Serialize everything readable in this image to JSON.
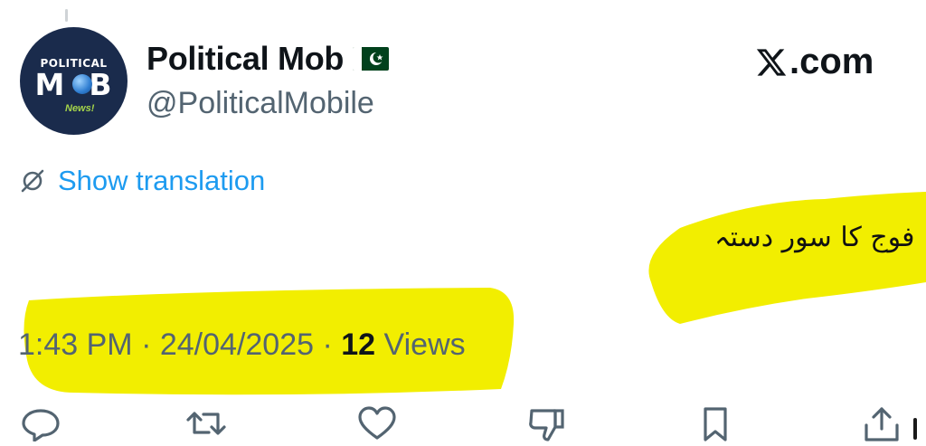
{
  "author": {
    "name": "Political Mob",
    "handle": "@PoliticalMobile",
    "flag_icon": "pakistan-flag-icon",
    "avatar": {
      "line1": "POLITICAL",
      "line2_left": "M",
      "line2_right": "B",
      "line3": "News!"
    }
  },
  "site_label": ".com",
  "site_logo_icon": "x-logo-icon",
  "translate": {
    "icon": "globe-slash-icon",
    "label": "Show translation"
  },
  "post_text": "فوج کا سور دستہ",
  "meta": {
    "time": "1:43 PM",
    "date": "24/04/2025",
    "views_count": "12",
    "views_label": "Views",
    "separator": "·"
  },
  "actions": [
    "reply-icon",
    "repost-icon",
    "like-icon",
    "dislike-icon",
    "bookmark-icon",
    "share-icon"
  ],
  "colors": {
    "highlight": "#f2ee00",
    "link": "#1d9bf0",
    "muted": "#536471",
    "avatar_bg": "#1a2b4c"
  }
}
